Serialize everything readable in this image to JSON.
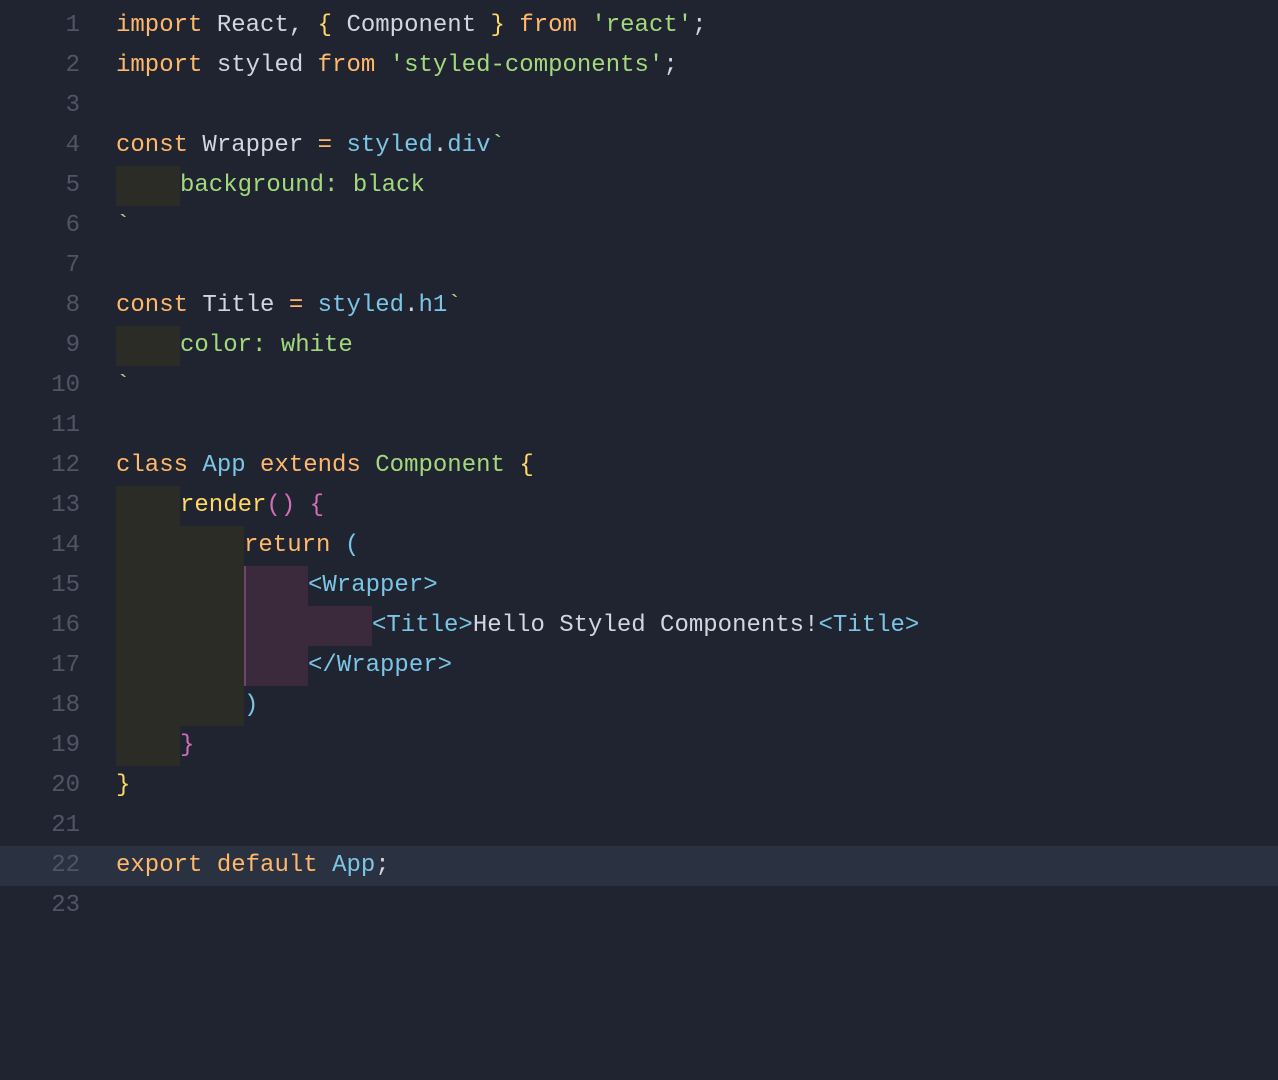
{
  "lines": {
    "total": 23,
    "highlighted": 22
  },
  "tokens": {
    "l1": {
      "kw_import": "import",
      "react": "React",
      "comma": ",",
      "brace_l": "{",
      "component": "Component",
      "brace_r": "}",
      "kw_from": "from",
      "str": "'react'",
      "semi": ";"
    },
    "l2": {
      "kw_import": "import",
      "styled": "styled",
      "kw_from": "from",
      "str": "'styled-components'",
      "semi": ";"
    },
    "l4": {
      "kw_const": "const",
      "wrapper": "Wrapper",
      "eq": "=",
      "styled": "styled",
      "dot": ".",
      "div": "div",
      "tick": "`"
    },
    "l5": {
      "css": "background: black"
    },
    "l6": {
      "tick": "`"
    },
    "l8": {
      "kw_const": "const",
      "title": "Title",
      "eq": "=",
      "styled": "styled",
      "dot": ".",
      "h1": "h1",
      "tick": "`"
    },
    "l9": {
      "css": "color: white"
    },
    "l10": {
      "tick": "`"
    },
    "l12": {
      "kw_class": "class",
      "app": "App",
      "kw_extends": "extends",
      "component": "Component",
      "brace_l": "{"
    },
    "l13": {
      "render": "render",
      "paren_l": "(",
      "paren_r": ")",
      "brace_l": "{"
    },
    "l14": {
      "kw_return": "return",
      "paren_l": "("
    },
    "l15": {
      "lt": "<",
      "wrapper": "Wrapper",
      "gt": ">"
    },
    "l16": {
      "lt1": "<",
      "title1": "Title",
      "gt1": ">",
      "content": "Hello Styled Components!",
      "lt2": "<",
      "title2": "Title",
      "gt2": ">"
    },
    "l17": {
      "lt": "<",
      "slash": "/",
      "wrapper": "Wrapper",
      "gt": ">"
    },
    "l18": {
      "paren_r": ")"
    },
    "l19": {
      "brace_r": "}"
    },
    "l20": {
      "brace_r": "}"
    },
    "l22": {
      "kw_export": "export",
      "kw_default": "default",
      "app": "App",
      "semi": ";"
    }
  },
  "chart_data": null
}
